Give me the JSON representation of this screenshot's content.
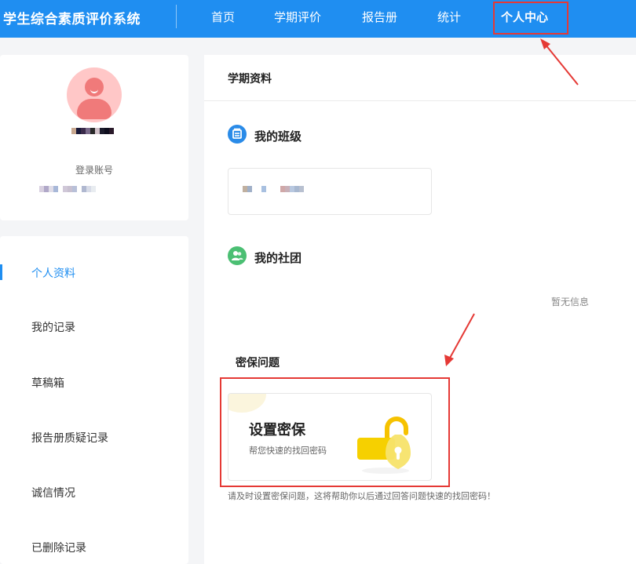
{
  "header": {
    "app_title": "学生综合素质评价系统",
    "nav": [
      {
        "label": "首页"
      },
      {
        "label": "学期评价"
      },
      {
        "label": "报告册"
      },
      {
        "label": "统计"
      },
      {
        "label": "个人中心",
        "active": true
      }
    ],
    "bg_color": "#1f8ef1"
  },
  "profile": {
    "login_label": "登录账号"
  },
  "side_menu": {
    "items": [
      {
        "label": "个人资料",
        "active": true
      },
      {
        "label": "我的记录"
      },
      {
        "label": "草稿箱"
      },
      {
        "label": "报告册质疑记录"
      },
      {
        "label": "诚信情况"
      },
      {
        "label": "已删除记录"
      }
    ],
    "active_color": "#1f8ef1"
  },
  "main": {
    "panel_title": "学期资料",
    "my_class": {
      "title": "我的班级",
      "icon": "class-icon"
    },
    "my_club": {
      "title": "我的社团",
      "icon": "club-icon",
      "empty_text": "暂无信息"
    },
    "security": {
      "section_title": "密保问题",
      "card_title": "设置密保",
      "card_subtitle": "帮您快速的找回密码",
      "icon": "lock-icon",
      "hint": "请及时设置密保问题，这将帮助你以后通过回答问题快速的找回密码！"
    }
  },
  "annotation_color": "#e53935"
}
